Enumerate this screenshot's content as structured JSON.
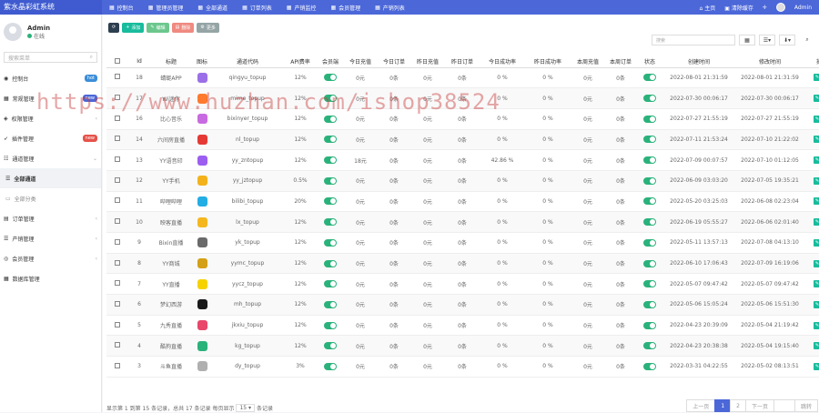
{
  "app": {
    "title": "紫水晶彩虹系统"
  },
  "topnav": [
    {
      "icon": "▦",
      "label": "控制台"
    },
    {
      "icon": "▦",
      "label": "管理员管理"
    },
    {
      "icon": "▦",
      "label": "全部通道"
    },
    {
      "icon": "▦",
      "label": "订单列表"
    },
    {
      "icon": "▦",
      "label": "产销监控"
    },
    {
      "icon": "▦",
      "label": "会员管理"
    },
    {
      "icon": "▦",
      "label": "产销列表"
    }
  ],
  "topright": {
    "home": "主页",
    "clear": "清除缓存",
    "admin": "Admin"
  },
  "user": {
    "name": "Admin",
    "status": "在线"
  },
  "sidebar": {
    "search_placeholder": "搜索菜单",
    "items": [
      {
        "label": "控制台",
        "badge": "hot",
        "badge_color": "#3b8ed8"
      },
      {
        "label": "常规管理",
        "badge": "new",
        "badge_color": "#4b67d8"
      },
      {
        "label": "权限管理",
        "chev": "‹"
      },
      {
        "label": "插件管理",
        "badge": "new",
        "badge_color": "#e5534b"
      },
      {
        "label": "通道管理",
        "chev": "⌄"
      },
      {
        "label": "全部通道"
      },
      {
        "label": "全部分类"
      },
      {
        "label": "订单管理",
        "chev": "‹"
      },
      {
        "label": "产销管理",
        "chev": "‹"
      },
      {
        "label": "会员管理",
        "chev": "‹"
      },
      {
        "label": "数据库管理"
      }
    ]
  },
  "toolbar": {
    "refresh": "⟳",
    "add": "添加",
    "edit": "编辑",
    "delete": "删除",
    "more": "更多",
    "search_placeholder": "搜索"
  },
  "table": {
    "headers": [
      "",
      "Id",
      "标题",
      "图标",
      "通道代码",
      "API费率",
      "会员端",
      "今日充值",
      "今日订单",
      "昨日充值",
      "昨日订单",
      "今日成功率",
      "昨日成功率",
      "本周充值",
      "本周订单",
      "状态",
      "创建时间",
      "修改时间",
      "操作"
    ],
    "rows": [
      {
        "id": "18",
        "title": "蜻蜓APP",
        "icon_color": "#9b6fe8",
        "code": "qingyu_topup",
        "rate": "12%",
        "today": "0元",
        "todayOrd": "0条",
        "yday": "0元",
        "ydayOrd": "0条",
        "todayRate": "0 %",
        "ydayRate": "0 %",
        "week": "0元",
        "weekOrd": "0条",
        "created": "2022-08-01 21:31:59",
        "updated": "2022-08-01 21:31:59"
      },
      {
        "id": "17",
        "title": "Wi迷你",
        "icon_color": "#ff7a2f",
        "code": "mime_topup",
        "rate": "12%",
        "today": "0元",
        "todayOrd": "0条",
        "yday": "0元",
        "ydayOrd": "0条",
        "todayRate": "0 %",
        "ydayRate": "0 %",
        "week": "0元",
        "weekOrd": "0条",
        "created": "2022-07-30 00:06:17",
        "updated": "2022-07-30 00:06:17"
      },
      {
        "id": "16",
        "title": "比心音乐",
        "icon_color": "#c86be0",
        "code": "bixinyer_topup",
        "rate": "12%",
        "today": "0元",
        "todayOrd": "0条",
        "yday": "0元",
        "ydayOrd": "0条",
        "todayRate": "0 %",
        "ydayRate": "0 %",
        "week": "0元",
        "weekOrd": "0条",
        "created": "2022-07-27 21:55:19",
        "updated": "2022-07-27 21:55:19"
      },
      {
        "id": "14",
        "title": "六间房直播",
        "icon_color": "#e53935",
        "code": "nl_topup",
        "rate": "12%",
        "today": "0元",
        "todayOrd": "0条",
        "yday": "0元",
        "ydayOrd": "0条",
        "todayRate": "0 %",
        "ydayRate": "0 %",
        "week": "0元",
        "weekOrd": "0条",
        "created": "2022-07-11 21:53:24",
        "updated": "2022-07-10 21:22:02"
      },
      {
        "id": "13",
        "title": "YY语音印",
        "icon_color": "#9c5ef0",
        "code": "yy_zntopup",
        "rate": "12%",
        "today": "18元",
        "todayOrd": "0条",
        "yday": "0元",
        "ydayOrd": "0条",
        "todayRate": "42.86 %",
        "ydayRate": "0 %",
        "week": "0元",
        "weekOrd": "0条",
        "created": "2022-07-09 00:07:57",
        "updated": "2022-07-10 01:12:05"
      },
      {
        "id": "12",
        "title": "YY手机",
        "icon_color": "#f3b21c",
        "code": "yy_jztopup",
        "rate": "0.5%",
        "today": "0元",
        "todayOrd": "0条",
        "yday": "0元",
        "ydayOrd": "0条",
        "todayRate": "0 %",
        "ydayRate": "0 %",
        "week": "0元",
        "weekOrd": "0条",
        "created": "2022-06-09 03:03:20",
        "updated": "2022-07-05 19:35:21"
      },
      {
        "id": "11",
        "title": "哔哩哔哩",
        "icon_color": "#23ade5",
        "code": "bilibi_topup",
        "rate": "20%",
        "today": "0元",
        "todayOrd": "0条",
        "yday": "0元",
        "ydayOrd": "0条",
        "todayRate": "0 %",
        "ydayRate": "0 %",
        "week": "0元",
        "weekOrd": "0条",
        "created": "2022-05-20 03:25:03",
        "updated": "2022-06-08 02:23:04"
      },
      {
        "id": "10",
        "title": "映客直播",
        "icon_color": "#f5b71f",
        "code": "lx_topup",
        "rate": "12%",
        "today": "0元",
        "todayOrd": "0条",
        "yday": "0元",
        "ydayOrd": "0条",
        "todayRate": "0 %",
        "ydayRate": "0 %",
        "week": "0元",
        "weekOrd": "0条",
        "created": "2022-06-19 05:55:27",
        "updated": "2022-06-06 02:01:40"
      },
      {
        "id": "9",
        "title": "Bixin直播",
        "icon_color": "#6a6a6a",
        "code": "yk_topup",
        "rate": "12%",
        "today": "0元",
        "todayOrd": "0条",
        "yday": "0元",
        "ydayOrd": "0条",
        "todayRate": "0 %",
        "ydayRate": "0 %",
        "week": "0元",
        "weekOrd": "0条",
        "created": "2022-05-11 13:57:13",
        "updated": "2022-07-08 04:13:10"
      },
      {
        "id": "8",
        "title": "YY商城",
        "icon_color": "#d4a017",
        "code": "yymc_topup",
        "rate": "12%",
        "today": "0元",
        "todayOrd": "0条",
        "yday": "0元",
        "ydayOrd": "0条",
        "todayRate": "0 %",
        "ydayRate": "0 %",
        "week": "0元",
        "weekOrd": "0条",
        "created": "2022-06-10 17:06:43",
        "updated": "2022-07-09 16:19:06"
      },
      {
        "id": "7",
        "title": "YY直播",
        "icon_color": "#f6d200",
        "code": "yycz_topup",
        "rate": "12%",
        "today": "0元",
        "todayOrd": "0条",
        "yday": "0元",
        "ydayOrd": "0条",
        "todayRate": "0 %",
        "ydayRate": "0 %",
        "week": "0元",
        "weekOrd": "0条",
        "created": "2022-05-07 09:47:42",
        "updated": "2022-05-07 09:47:42"
      },
      {
        "id": "6",
        "title": "梦幻西游",
        "icon_color": "#1a1a1a",
        "code": "mh_topup",
        "rate": "12%",
        "today": "0元",
        "todayOrd": "0条",
        "yday": "0元",
        "ydayOrd": "0条",
        "todayRate": "0 %",
        "ydayRate": "0 %",
        "week": "0元",
        "weekOrd": "0条",
        "created": "2022-05-06 15:05:24",
        "updated": "2022-05-06 15:51:30"
      },
      {
        "id": "5",
        "title": "九秀直播",
        "icon_color": "#e8466a",
        "code": "jkxiu_topup",
        "rate": "12%",
        "today": "0元",
        "todayOrd": "0条",
        "yday": "0元",
        "ydayOrd": "0条",
        "todayRate": "0 %",
        "ydayRate": "0 %",
        "week": "0元",
        "weekOrd": "0条",
        "created": "2022-04-23 20:39:09",
        "updated": "2022-05-04 21:19:42"
      },
      {
        "id": "4",
        "title": "酷狗直播",
        "icon_color": "#2ab27b",
        "code": "kg_topup",
        "rate": "12%",
        "today": "0元",
        "todayOrd": "0条",
        "yday": "0元",
        "ydayOrd": "0条",
        "todayRate": "0 %",
        "ydayRate": "0 %",
        "week": "0元",
        "weekOrd": "0条",
        "created": "2022-04-23 20:38:38",
        "updated": "2022-05-04 19:15:40"
      },
      {
        "id": "3",
        "title": "斗鱼直播",
        "icon_color": "#b0b0b0",
        "code": "dy_topup",
        "rate": "3%",
        "today": "0元",
        "todayOrd": "0条",
        "yday": "0元",
        "ydayOrd": "0条",
        "todayRate": "0 %",
        "ydayRate": "0 %",
        "week": "0元",
        "weekOrd": "0条",
        "created": "2022-03-31 04:22:55",
        "updated": "2022-05-02 08:13:51"
      }
    ]
  },
  "pager": {
    "summary": "显示第 1 到第 15 条记录，总共 17 条记录 每页显示",
    "size": "15",
    "suffix": "条记录",
    "prev": "上一页",
    "p1": "1",
    "p2": "2",
    "next": "下一页",
    "go": "跳转"
  },
  "watermark": "https://www.huzhan.com/ishop38524",
  "colors": {
    "primary": "#4b67d8",
    "success": "#2ab27b",
    "danger": "#e5534b"
  }
}
